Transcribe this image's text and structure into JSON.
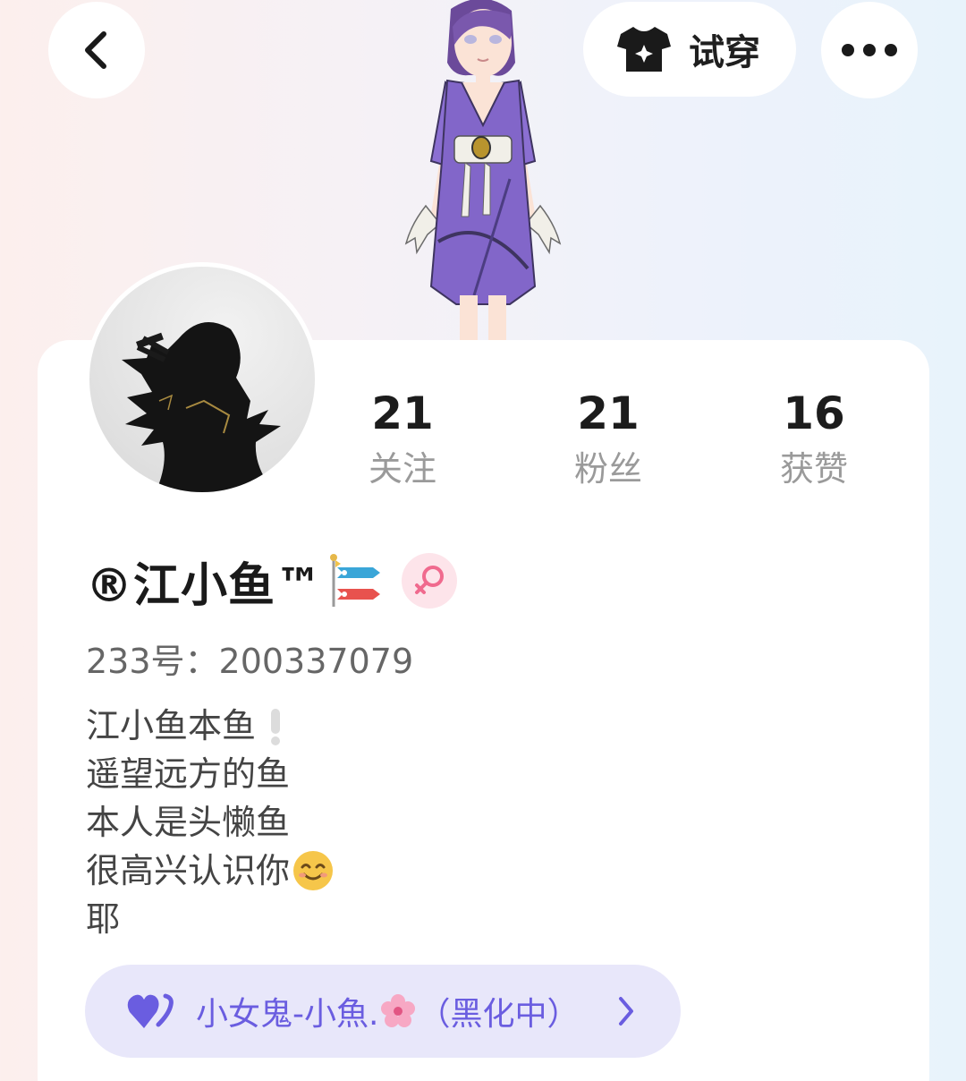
{
  "top_bar": {
    "back_icon": "chevron-left-icon",
    "tryon_label": "试穿",
    "tryon_icon": "shirt-sparkle-icon",
    "more_icon": "more-dots-icon"
  },
  "profile": {
    "username": "®江小鱼™",
    "username_decoration": "koinobori-emoji",
    "gender": "female",
    "uid": "233号：200337079"
  },
  "stats": [
    {
      "value": "21",
      "label": "关注"
    },
    {
      "value": "21",
      "label": "粉丝"
    },
    {
      "value": "16",
      "label": "获赞"
    }
  ],
  "bio": {
    "lines": [
      "江小鱼本鱼",
      "遥望远方的鱼",
      "本人是头懒鱼",
      "很高兴认识你",
      "耶"
    ]
  },
  "group": {
    "name": "小女鬼-小魚.",
    "suffix": "（黑化中）",
    "icon": "double-heart-icon"
  },
  "colors": {
    "accent": "#6a5de0",
    "pill_bg": "#e8e7fa",
    "gender_badge_bg": "#fde4ea",
    "gender_symbol": "#f06a8e"
  }
}
